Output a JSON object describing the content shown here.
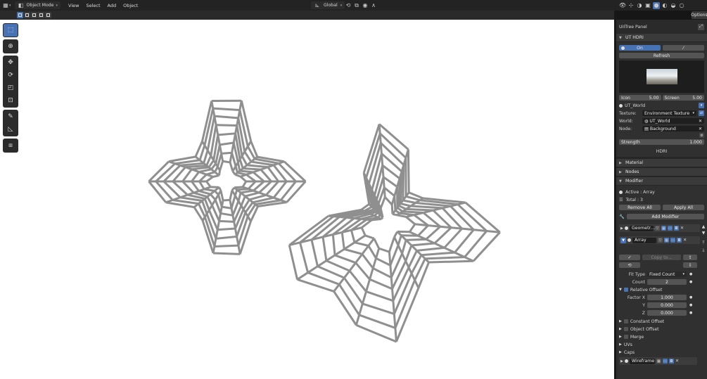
{
  "header": {
    "mode": "Object Mode",
    "menus": [
      "View",
      "Select",
      "Add",
      "Object"
    ],
    "orientation": "Global",
    "options_label": "Options"
  },
  "sidebar": {
    "panel_title": "UIITree Panel",
    "hdri": {
      "title": "UT HDRI",
      "toggle_label": "On",
      "refresh_label": "Refresh",
      "icon_label": "Icon",
      "icon_value": "5.00",
      "screen_label": "Screen",
      "screen_value": "5.00",
      "world_name": "UT_World",
      "texture_label": "Texture:",
      "texture_value": "Environment Texture",
      "world_label": "World:",
      "world_value": "UT_World",
      "node_label": "Node:",
      "node_value": "Background",
      "strength_label": "Strength",
      "strength_value": "1.000",
      "footer_label": "HDRI"
    },
    "material_label": "Material",
    "nodes_label": "Nodes",
    "modifier": {
      "title": "Modifier",
      "active_text": "Active : Array",
      "total_text": "Total : 3",
      "remove_all": "Remove All",
      "apply_all": "Apply All",
      "add_modifier": "Add Modifier",
      "mod1_name": "Geometr…",
      "mod2_name": "Array",
      "copy_to": "Copy to…",
      "fit_type_label": "Fit Type",
      "fit_type_value": "Fixed Count",
      "count_label": "Count",
      "count_value": "2",
      "relative_offset": "Relative Offset",
      "factor_x_label": "Factor X",
      "factor_x": "1.000",
      "y_label": "Y",
      "y_value": "0.000",
      "z_label": "Z",
      "z_value": "0.000",
      "constant_offset": "Constant Offset",
      "object_offset": "Object Offset",
      "merge": "Merge",
      "uvs": "UVs",
      "caps": "Caps",
      "mod3_name": "Wireframe"
    }
  },
  "colors": {
    "accent": "#4772b3",
    "panel_bg": "#303030",
    "header_bg": "#232323",
    "viewport_bg": "#ffffff",
    "mesh": "#8f8f8f"
  },
  "toolbar_icons": [
    "select-box-icon",
    "cursor-icon",
    "move-icon",
    "rotate-icon",
    "scale-icon",
    "transform-icon",
    "annotate-icon",
    "measure-icon",
    "add-cube-icon"
  ]
}
